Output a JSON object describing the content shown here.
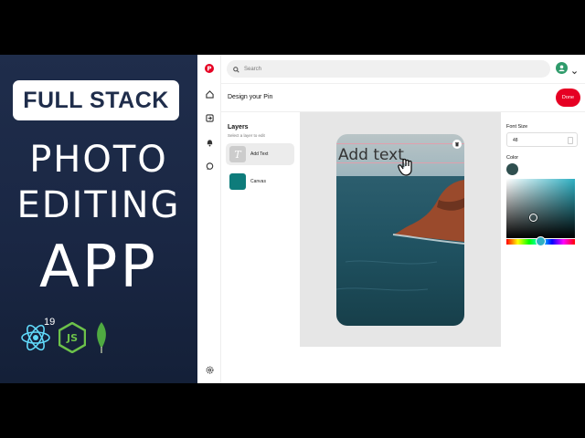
{
  "banner": {
    "badge": "FULL STACK",
    "line1": "PHOTO",
    "line2": "EDITING",
    "line3": "APP",
    "react_version": "19"
  },
  "topbar": {
    "search_placeholder": "Search"
  },
  "header": {
    "title": "Design your Pin",
    "done_label": "Done"
  },
  "layers": {
    "heading": "Layers",
    "subtitle": "Select a layer to edit",
    "items": [
      {
        "label": "Add Text",
        "thumb": "T"
      },
      {
        "label": "Canvas"
      }
    ]
  },
  "canvas": {
    "text": "Add text"
  },
  "properties": {
    "font_size_label": "Font Size",
    "font_size_value": "48",
    "color_label": "Color"
  },
  "colors": {
    "accent": "#e60023",
    "text_color": "#2f4f4f",
    "canvas_layer": "#0e7c7b",
    "banner_bg": "#1f2d4b"
  },
  "icons": [
    "pinterest-logo-icon",
    "home-icon",
    "upload-icon",
    "bell-icon",
    "chat-icon",
    "settings-icon",
    "search-icon",
    "chevron-down-icon",
    "trash-icon",
    "hand-cursor-icon",
    "react-icon",
    "nodejs-icon",
    "mongodb-icon"
  ]
}
